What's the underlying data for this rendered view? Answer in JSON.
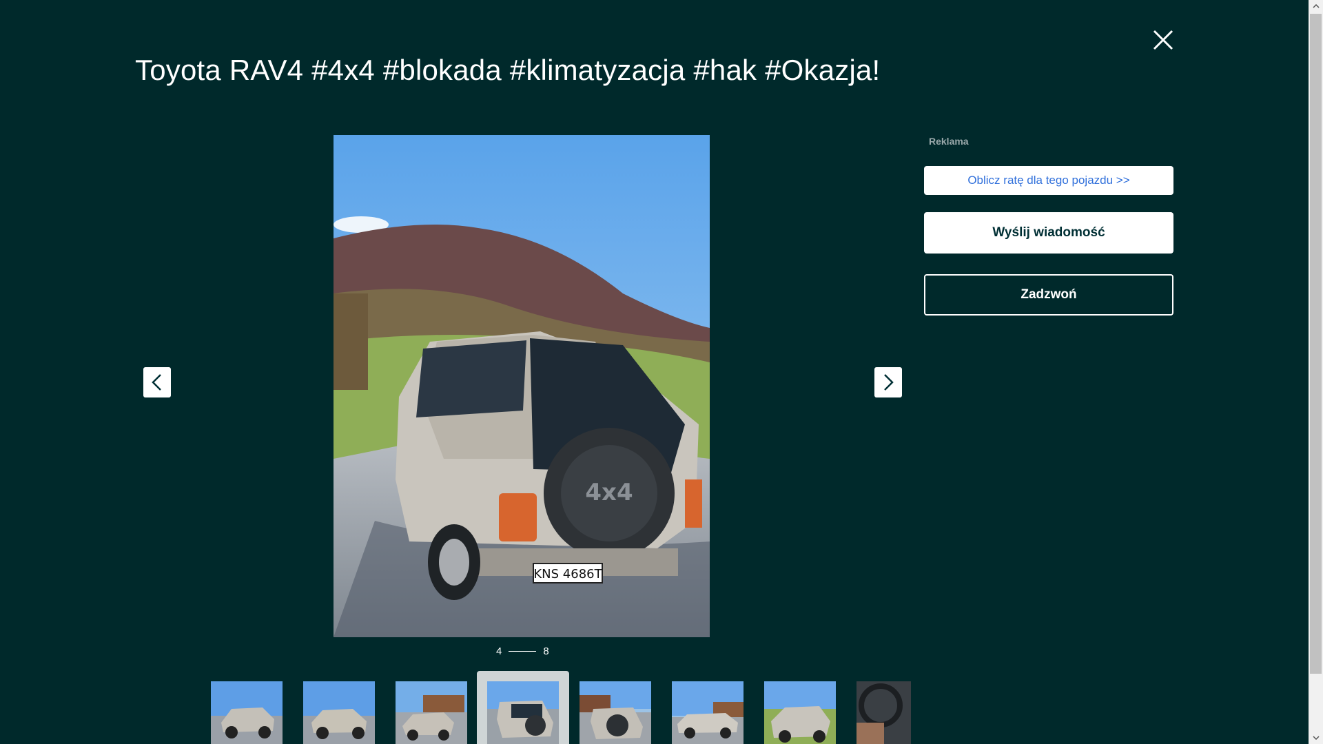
{
  "listing": {
    "title": "Toyota RAV4 #4x4 #blokada #klimatyzacja #hak #Okazja!"
  },
  "gallery": {
    "current": "4",
    "total": "8",
    "main_plate_text": "KNS 4686T",
    "spare_cover_text": "4x4",
    "thumbnails": [
      {
        "label": "photo-1",
        "active": false
      },
      {
        "label": "photo-2",
        "active": false
      },
      {
        "label": "photo-3",
        "active": false
      },
      {
        "label": "photo-4",
        "active": true
      },
      {
        "label": "photo-5",
        "active": false
      },
      {
        "label": "photo-6",
        "active": false
      },
      {
        "label": "photo-7",
        "active": false
      },
      {
        "label": "photo-8",
        "active": false
      }
    ]
  },
  "sidebar": {
    "ad_label": "Reklama",
    "calc_button": "Oblicz ratę dla tego pojazdu >>",
    "message_button": "Wyślij wiadomość",
    "call_button": "Zadzwoń"
  },
  "icons": {
    "close": "close-icon",
    "prev": "chevron-left-icon",
    "next": "chevron-right-icon"
  },
  "colors": {
    "background": "#00292b",
    "link_blue": "#2f6fdb",
    "dark_text": "#002f34"
  }
}
